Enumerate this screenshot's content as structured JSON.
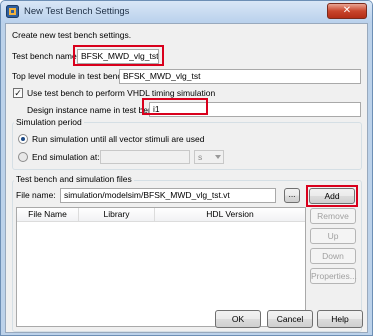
{
  "window": {
    "title": "New Test Bench Settings",
    "close_glyph": "✕",
    "app_icon": "quartus-app-icon"
  },
  "intro_text": "Create new test bench settings.",
  "testbench_name": {
    "label": "Test bench name:",
    "value": "BFSK_MWD_vlg_tst"
  },
  "top_level_module": {
    "label": "Top level module in test bench:",
    "value": "BFSK_MWD_vlg_tst"
  },
  "vhdl_timing": {
    "label": "Use test bench to perform VHDL timing simulation",
    "checked": true,
    "check_glyph": "✓"
  },
  "design_instance": {
    "label": "Design instance name in test bench:",
    "value": "i1"
  },
  "simulation_period": {
    "title": "Simulation period",
    "option_run_all": "Run simulation until all vector stimuli are used",
    "option_end_at": "End simulation at:",
    "selected": "run_all",
    "end_value": "",
    "unit": "s"
  },
  "files": {
    "title": "Test bench and simulation files",
    "file_name_label": "File name:",
    "file_name_value": "simulation/modelsim/BFSK_MWD_vlg_tst.vt",
    "browse_label": "...",
    "columns": [
      "File Name",
      "Library",
      "HDL Version"
    ],
    "rows": []
  },
  "side_buttons": {
    "add": "Add",
    "remove": "Remove",
    "up": "Up",
    "down": "Down",
    "properties": "Properties..."
  },
  "footer": {
    "ok": "OK",
    "cancel": "Cancel",
    "help": "Help"
  },
  "colors": {
    "highlight_red": "#d9001c",
    "frame_blue": "#bcd2ea",
    "close_red": "#c9452c"
  }
}
